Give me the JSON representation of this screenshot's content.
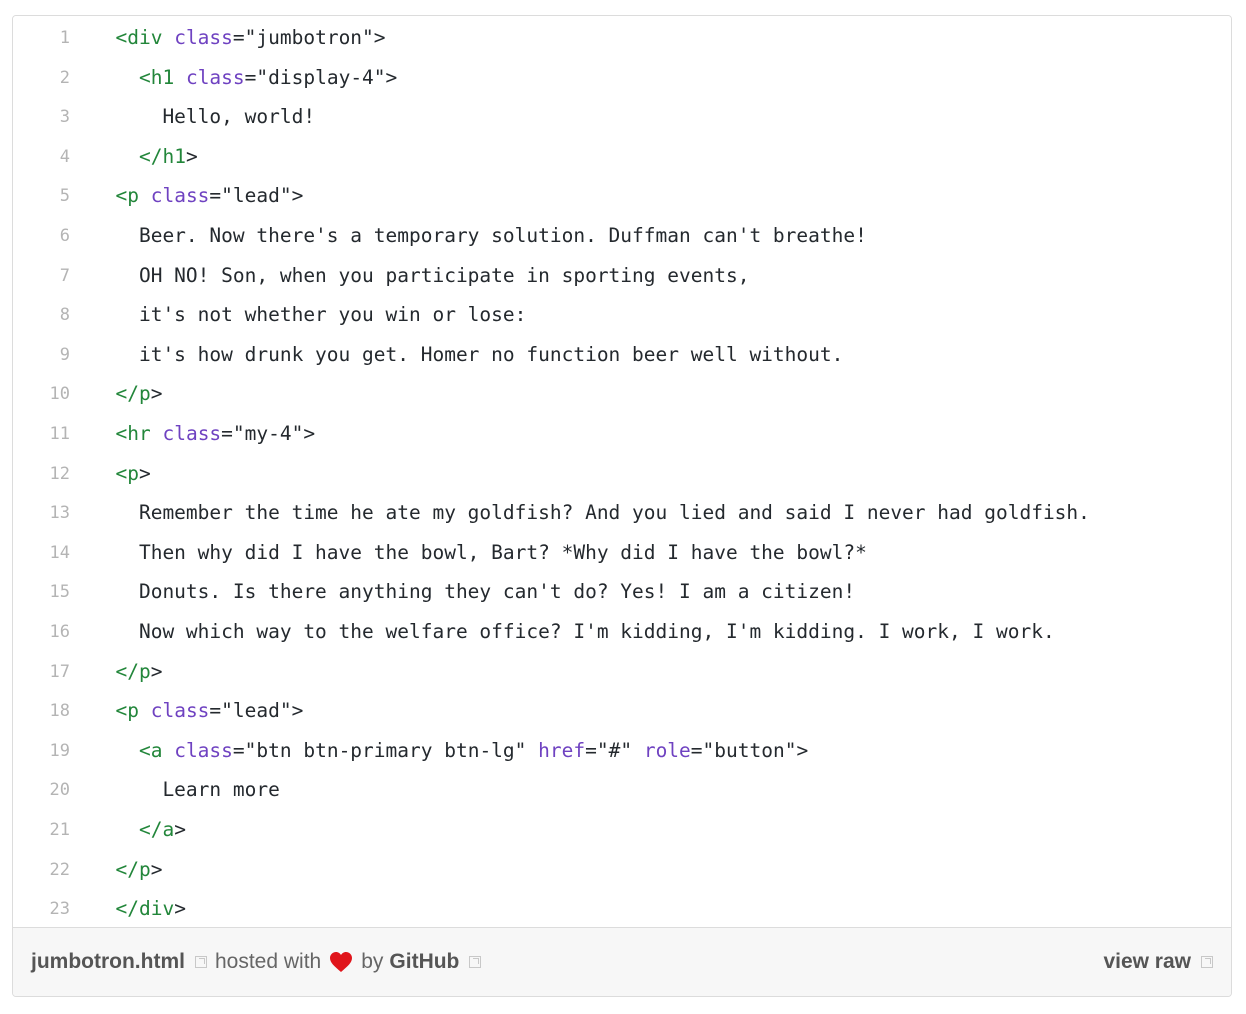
{
  "gist": {
    "lines": [
      {
        "n": "1",
        "tokens": [
          {
            "t": "  ",
            "c": "st"
          },
          {
            "t": "<div",
            "c": "tg"
          },
          {
            "t": " ",
            "c": "st"
          },
          {
            "t": "class",
            "c": "at"
          },
          {
            "t": "=\"jumbotron\">",
            "c": "st"
          }
        ]
      },
      {
        "n": "2",
        "tokens": [
          {
            "t": "    ",
            "c": "st"
          },
          {
            "t": "<h1",
            "c": "tg"
          },
          {
            "t": " ",
            "c": "st"
          },
          {
            "t": "class",
            "c": "at"
          },
          {
            "t": "=\"display-4\">",
            "c": "st"
          }
        ]
      },
      {
        "n": "3",
        "tokens": [
          {
            "t": "      Hello, world!",
            "c": "st"
          }
        ]
      },
      {
        "n": "4",
        "tokens": [
          {
            "t": "    ",
            "c": "st"
          },
          {
            "t": "</h1",
            "c": "tg"
          },
          {
            "t": ">",
            "c": "st"
          }
        ]
      },
      {
        "n": "5",
        "tokens": [
          {
            "t": "  ",
            "c": "st"
          },
          {
            "t": "<p",
            "c": "tg"
          },
          {
            "t": " ",
            "c": "st"
          },
          {
            "t": "class",
            "c": "at"
          },
          {
            "t": "=\"lead\">",
            "c": "st"
          }
        ]
      },
      {
        "n": "6",
        "tokens": [
          {
            "t": "    Beer. Now there's a temporary solution. Duffman can't breathe!",
            "c": "st"
          }
        ]
      },
      {
        "n": "7",
        "tokens": [
          {
            "t": "    OH NO! Son, when you participate in sporting events,",
            "c": "st"
          }
        ]
      },
      {
        "n": "8",
        "tokens": [
          {
            "t": "    it's not whether you win or lose:",
            "c": "st"
          }
        ]
      },
      {
        "n": "9",
        "tokens": [
          {
            "t": "    it's how drunk you get. Homer no function beer well without.",
            "c": "st"
          }
        ]
      },
      {
        "n": "10",
        "tokens": [
          {
            "t": "  ",
            "c": "st"
          },
          {
            "t": "</p",
            "c": "tg"
          },
          {
            "t": ">",
            "c": "st"
          }
        ]
      },
      {
        "n": "11",
        "tokens": [
          {
            "t": "  ",
            "c": "st"
          },
          {
            "t": "<hr",
            "c": "tg"
          },
          {
            "t": " ",
            "c": "st"
          },
          {
            "t": "class",
            "c": "at"
          },
          {
            "t": "=\"my-4\">",
            "c": "st"
          }
        ]
      },
      {
        "n": "12",
        "tokens": [
          {
            "t": "  ",
            "c": "st"
          },
          {
            "t": "<p",
            "c": "tg"
          },
          {
            "t": ">",
            "c": "st"
          }
        ]
      },
      {
        "n": "13",
        "tokens": [
          {
            "t": "    Remember the time he ate my goldfish? And you lied and said I never had goldfish.",
            "c": "st"
          }
        ]
      },
      {
        "n": "14",
        "tokens": [
          {
            "t": "    Then why did I have the bowl, Bart? *Why did I have the bowl?*",
            "c": "st"
          }
        ]
      },
      {
        "n": "15",
        "tokens": [
          {
            "t": "    Donuts. Is there anything they can't do? Yes! I am a citizen!",
            "c": "st"
          }
        ]
      },
      {
        "n": "16",
        "tokens": [
          {
            "t": "    Now which way to the welfare office? I'm kidding, I'm kidding. I work, I work.",
            "c": "st"
          }
        ]
      },
      {
        "n": "17",
        "tokens": [
          {
            "t": "  ",
            "c": "st"
          },
          {
            "t": "</p",
            "c": "tg"
          },
          {
            "t": ">",
            "c": "st"
          }
        ]
      },
      {
        "n": "18",
        "tokens": [
          {
            "t": "  ",
            "c": "st"
          },
          {
            "t": "<p",
            "c": "tg"
          },
          {
            "t": " ",
            "c": "st"
          },
          {
            "t": "class",
            "c": "at"
          },
          {
            "t": "=\"lead\">",
            "c": "st"
          }
        ]
      },
      {
        "n": "19",
        "tokens": [
          {
            "t": "    ",
            "c": "st"
          },
          {
            "t": "<a",
            "c": "tg"
          },
          {
            "t": " ",
            "c": "st"
          },
          {
            "t": "class",
            "c": "at"
          },
          {
            "t": "=\"btn btn-primary btn-lg\" ",
            "c": "st"
          },
          {
            "t": "href",
            "c": "at"
          },
          {
            "t": "=\"#\" ",
            "c": "st"
          },
          {
            "t": "role",
            "c": "at"
          },
          {
            "t": "=\"button\">",
            "c": "st"
          }
        ]
      },
      {
        "n": "20",
        "tokens": [
          {
            "t": "      Learn more",
            "c": "st"
          }
        ]
      },
      {
        "n": "21",
        "tokens": [
          {
            "t": "    ",
            "c": "st"
          },
          {
            "t": "</a",
            "c": "tg"
          },
          {
            "t": ">",
            "c": "st"
          }
        ]
      },
      {
        "n": "22",
        "tokens": [
          {
            "t": "  ",
            "c": "st"
          },
          {
            "t": "</p",
            "c": "tg"
          },
          {
            "t": ">",
            "c": "st"
          }
        ]
      },
      {
        "n": "23",
        "tokens": [
          {
            "t": "  ",
            "c": "st"
          },
          {
            "t": "</div",
            "c": "tg"
          },
          {
            "t": ">",
            "c": "st"
          }
        ]
      }
    ]
  },
  "footer": {
    "filename": "jumbotron.html",
    "hosted_with": "hosted with",
    "by": "by",
    "github": "GitHub",
    "view_raw": "view raw",
    "heart_color": "#e0151b"
  },
  "colors": {
    "tag": "#22863a",
    "attr": "#6f42c1",
    "text": "#24292e",
    "line_number": "#b4b4b4"
  },
  "icons": {
    "external_link": "external-link-icon",
    "heart": "heart-icon"
  }
}
